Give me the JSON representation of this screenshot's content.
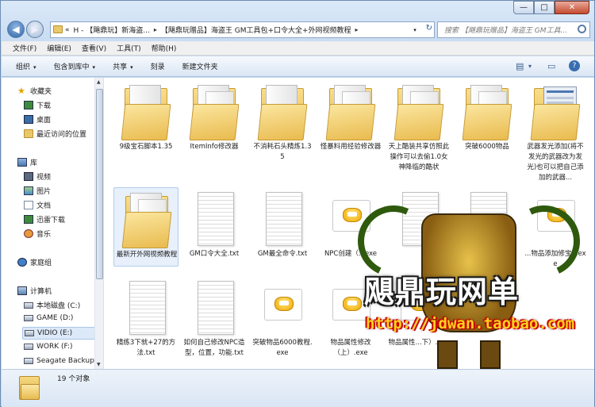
{
  "window": {
    "min_glyph": "—",
    "max_glyph": "□",
    "close_glyph": "✕"
  },
  "nav": {
    "recent_glyph": "«",
    "address_crumbs": [
      "H - 【飓鼎玩】新海盗...",
      "【飓鼎玩赠品】海盗王 GM工具包+口令大全+外网视频教程"
    ],
    "address_sep": "▸",
    "search_placeholder": "搜索 【飓鼎玩赠品】海盗王 GM工具...",
    "refresh_glyph": "↻",
    "dropdown_glyph": "▾"
  },
  "menubar": [
    "文件(F)",
    "编辑(E)",
    "查看(V)",
    "工具(T)",
    "帮助(H)"
  ],
  "toolbar": {
    "organize": "组织",
    "include_library": "包含到库中",
    "share": "共享",
    "burn": "刻录",
    "new_folder": "新建文件夹",
    "arrow": "▾",
    "view_glyph": "▤",
    "pane_glyph": "▭",
    "help_glyph": "?"
  },
  "navpane": {
    "favorites": "收藏夹",
    "downloads": "下载",
    "desktop": "桌面",
    "recent": "最近访问的位置",
    "libraries": "库",
    "videos": "视频",
    "pictures": "图片",
    "documents": "文档",
    "thunder": "迅雷下载",
    "music": "音乐",
    "homegroup": "家庭组",
    "computer": "计算机",
    "drive_c": "本地磁盘 (C:)",
    "drive_d": "GAME (D:)",
    "drive_e": "VIDIO (E:)",
    "drive_f": "WORK (F:)",
    "drive_g": "Seagate Backup",
    "star_glyph": "★",
    "scroll_up": "▲",
    "scroll_down": "▼"
  },
  "files": [
    {
      "name": "9级宝石脚本1.35",
      "type": "folder"
    },
    {
      "name": "ItemInfo修改器",
      "type": "folder"
    },
    {
      "name": "不消耗石头精炼1.35",
      "type": "folder"
    },
    {
      "name": "怪暴料用经验修改器",
      "type": "folder"
    },
    {
      "name": "天上酷装共享仿照此操作可以去偷1.0女神降临的酷状",
      "type": "folder"
    },
    {
      "name": "突破6000物品",
      "type": "folder"
    },
    {
      "name": "武器发光添加(将不发光的武器改为发光)也可以把自己添加的武器...",
      "type": "folder"
    },
    {
      "name": "最新开外网视频教程",
      "type": "folder"
    },
    {
      "name": "GM口令大全.txt",
      "type": "txt"
    },
    {
      "name": "GM最全命令.txt",
      "type": "txt"
    },
    {
      "name": "NPC创建（...exe",
      "type": "exe"
    },
    {
      "name": "",
      "type": "txt"
    },
    {
      "name": "",
      "type": "txt"
    },
    {
      "name": "...物品添加修宝...exe",
      "type": "exe"
    },
    {
      "name": "精练3下就+27的方法.txt",
      "type": "txt"
    },
    {
      "name": "如何自己修改NPC造型，位置，功能.txt",
      "type": "txt"
    },
    {
      "name": "突破物品6000教程.exe",
      "type": "exe"
    },
    {
      "name": "物品属性修改（上）.exe",
      "type": "exe"
    },
    {
      "name": "物品属性...下）.exe",
      "type": "exe"
    }
  ],
  "watermark": {
    "brand": "飓鼎玩网单",
    "url": "http://jdwan.taobao.com"
  },
  "status": {
    "count": "19 个对象"
  }
}
